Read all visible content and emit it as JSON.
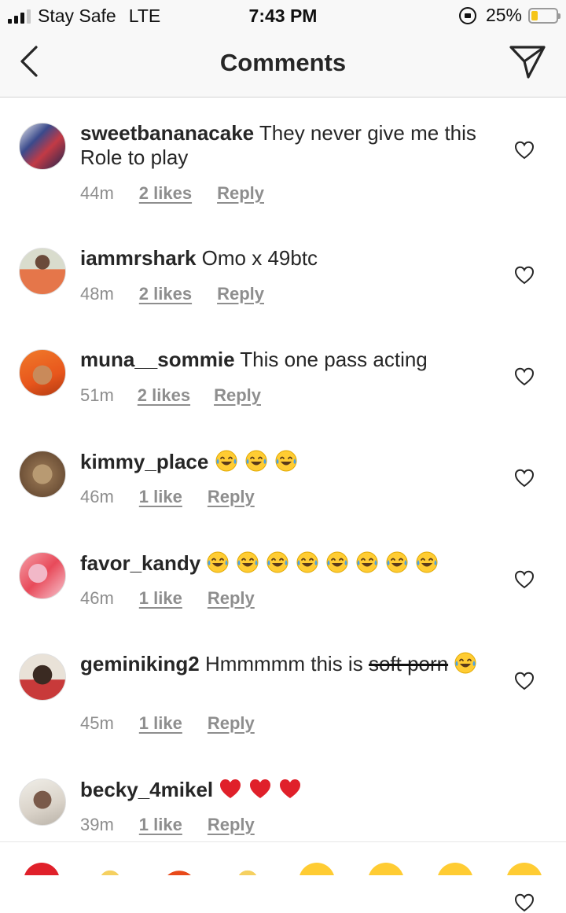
{
  "status_bar": {
    "carrier": "Stay Safe",
    "network": "LTE",
    "time": "7:43 PM",
    "battery_text": "25%",
    "battery_level": 0.25,
    "signal_bars": 3
  },
  "nav": {
    "title": "Comments",
    "back_icon": "chevron-left-icon",
    "send_icon": "paper-plane-icon"
  },
  "comments": [
    {
      "username": "sweetbananacake",
      "text": "They never give me this Role to play",
      "time": "44m",
      "likes": "2 likes",
      "reply": "Reply"
    },
    {
      "username": "iammrshark",
      "text": "Omo x 49btc",
      "time": "48m",
      "likes": "2 likes",
      "reply": "Reply"
    },
    {
      "username": "muna__sommie",
      "text": "This one pass acting",
      "time": "51m",
      "likes": "2 likes",
      "reply": "Reply"
    },
    {
      "username": "kimmy_place",
      "text": "",
      "emoji": "😂😂😂",
      "time": "46m",
      "likes": "1 like",
      "reply": "Reply"
    },
    {
      "username": "favor_kandy",
      "text": "",
      "emoji": "😂😂😂😂😂😂😂😂",
      "time": "46m",
      "likes": "1 like",
      "reply": "Reply"
    },
    {
      "username": "geminiking2",
      "text": "Hmmmmm this is",
      "struck": "soft porn",
      "emoji": "😂",
      "time": "45m",
      "likes": "1 like",
      "reply": "Reply"
    },
    {
      "username": "becky_4mikel",
      "text": "",
      "emoji": "❤️❤️❤️",
      "time": "39m",
      "likes": "1 like",
      "reply": "Reply"
    }
  ],
  "colors": {
    "text": "#262626",
    "meta": "#8e8e8e",
    "bar_background": "#f8f8f8",
    "emoji_face": "#ffcc33",
    "heart_red": "#e0202a"
  }
}
